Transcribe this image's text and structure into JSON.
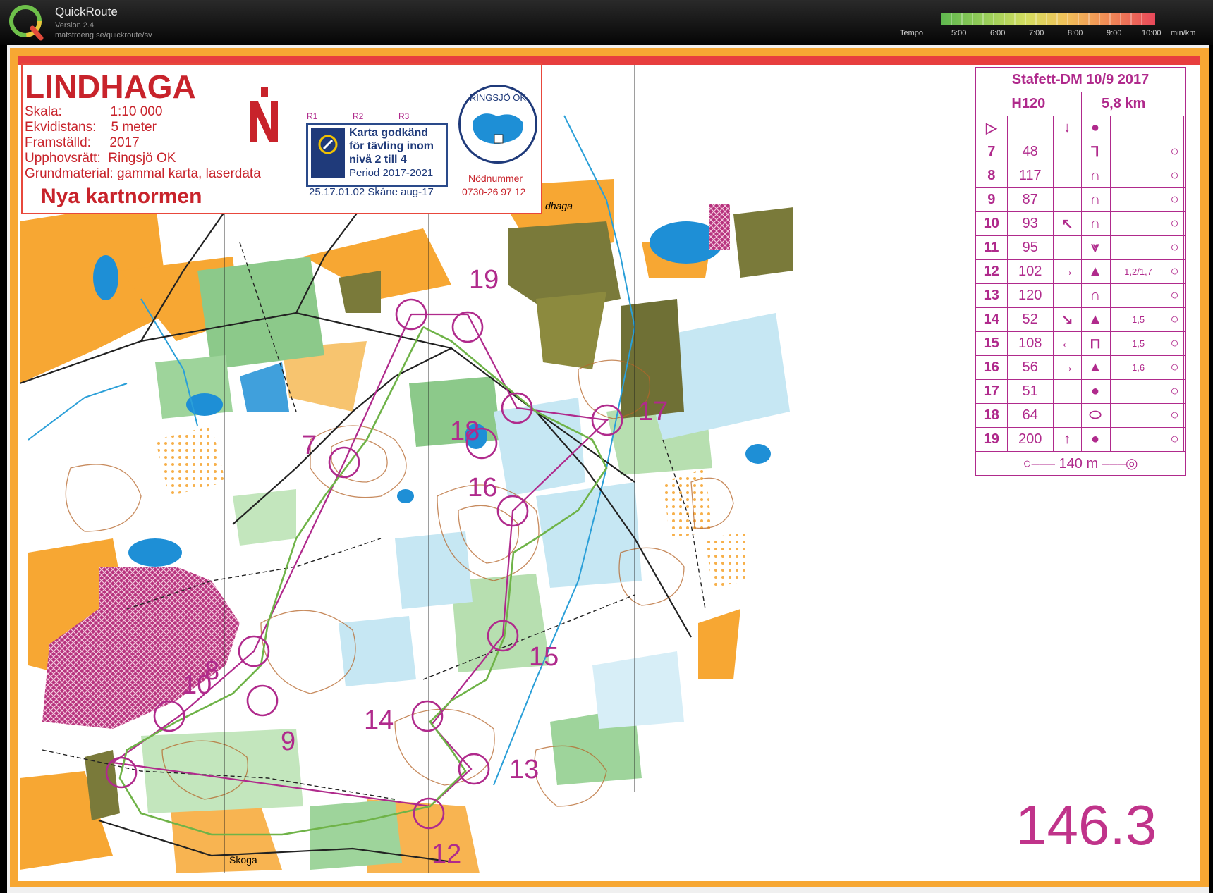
{
  "app": {
    "name": "QuickRoute",
    "version": "Version 2.4",
    "url": "matstroeng.se/quickroute/sv"
  },
  "tempo_legend": {
    "label": "Tempo",
    "ticks": [
      "5:00",
      "6:00",
      "7:00",
      "8:00",
      "9:00",
      "10:00"
    ],
    "unit": "min/km"
  },
  "map": {
    "title": "LINDHAGA",
    "info": [
      {
        "key": "Skala:",
        "value": "1:10 000"
      },
      {
        "key": "Ekvidistans:",
        "value": "5 meter"
      },
      {
        "key": "Framställd:",
        "value": "2017"
      },
      {
        "key": "Upphovsrätt:",
        "value": "Ringsjö OK"
      },
      {
        "key": "Grundmaterial:",
        "value": "gammal karta, laserdata"
      }
    ],
    "subtitle": "Nya kartnormen",
    "relay_boxes": [
      "R1",
      "R2",
      "R3"
    ],
    "approval": {
      "text": [
        "Karta godkänd",
        "för tävling inom",
        "nivå 2 till 4"
      ],
      "period": "Period 2017-2021",
      "code": "25.17.01.02 Skåne aug-17"
    },
    "club": "RINGSJÖ OK",
    "emergency_label": "Nödnummer",
    "emergency_number": "0730-26 97 12",
    "places": {
      "skoga": "Skoga",
      "lindhaga": "dhaga"
    },
    "map_number": "146.3",
    "controls": [
      {
        "num": "7",
        "label_x": 0.253,
        "label_y": 0.49
      },
      {
        "num": "8"
      },
      {
        "num": "9"
      },
      {
        "num": "10"
      },
      {
        "num": "12"
      },
      {
        "num": "13"
      },
      {
        "num": "14"
      },
      {
        "num": "15"
      },
      {
        "num": "16"
      },
      {
        "num": "17"
      },
      {
        "num": "18"
      },
      {
        "num": "19"
      }
    ]
  },
  "control_description": {
    "event": "Stafett-DM 10/9 2017",
    "course": "H120",
    "length": "5,8 km",
    "rows": [
      {
        "num": "7",
        "code": "48",
        "dir": "",
        "sym": "⅂",
        "extra": ""
      },
      {
        "num": "8",
        "code": "117",
        "dir": "",
        "sym": "∩",
        "extra": ""
      },
      {
        "num": "9",
        "code": "87",
        "dir": "",
        "sym": "∩",
        "extra": ""
      },
      {
        "num": "10",
        "code": "93",
        "dir": "↖",
        "sym": "∩",
        "extra": ""
      },
      {
        "num": "11",
        "code": "95",
        "dir": "",
        "sym": "⩔",
        "extra": ""
      },
      {
        "num": "12",
        "code": "102",
        "dir": "→",
        "sym": "▲",
        "extra": "1,2/1,7"
      },
      {
        "num": "13",
        "code": "120",
        "dir": "",
        "sym": "∩",
        "extra": ""
      },
      {
        "num": "14",
        "code": "52",
        "dir": "↘",
        "sym": "▲",
        "extra": "1,5"
      },
      {
        "num": "15",
        "code": "108",
        "dir": "←",
        "sym": "⊓",
        "extra": "1,5"
      },
      {
        "num": "16",
        "code": "56",
        "dir": "→",
        "sym": "▲",
        "extra": "1,6"
      },
      {
        "num": "17",
        "code": "51",
        "dir": "",
        "sym": "●",
        "extra": ""
      },
      {
        "num": "18",
        "code": "64",
        "dir": "",
        "sym": "⬭",
        "extra": ""
      },
      {
        "num": "19",
        "code": "200",
        "dir": "↑",
        "sym": "●",
        "extra": ""
      }
    ],
    "finish": "140 m"
  }
}
